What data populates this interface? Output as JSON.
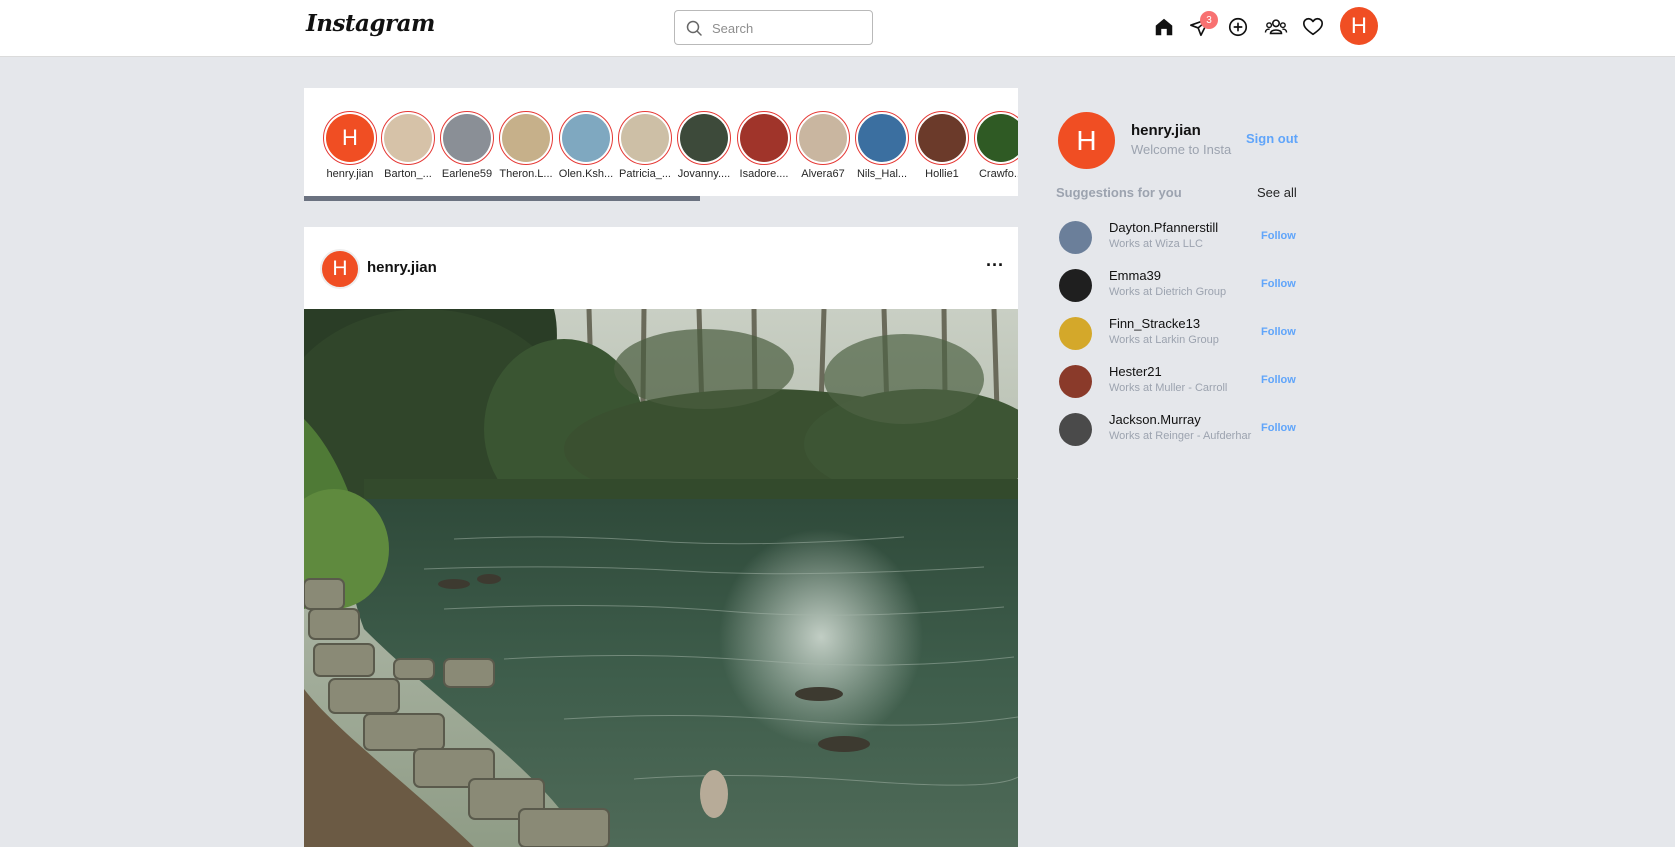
{
  "nav": {
    "logo": "Instagram",
    "search_placeholder": "Search",
    "messages_badge": "3",
    "avatar_initial": "H"
  },
  "stories": [
    {
      "name": "henry.jian",
      "initial": "H",
      "bg": "#f04e23"
    },
    {
      "name": "Barton_...",
      "bg": "#d6c2a8"
    },
    {
      "name": "Earlene59",
      "bg": "#8a8f96"
    },
    {
      "name": "Theron.L...",
      "bg": "#c6b08a"
    },
    {
      "name": "Olen.Ksh...",
      "bg": "#7fa8c0"
    },
    {
      "name": "Patricia_...",
      "bg": "#cdbfa6"
    },
    {
      "name": "Jovanny....",
      "bg": "#3d4a3a"
    },
    {
      "name": "Isadore....",
      "bg": "#a0342a"
    },
    {
      "name": "Alvera67",
      "bg": "#c9b6a0"
    },
    {
      "name": "Nils_Hal...",
      "bg": "#3b6fa0"
    },
    {
      "name": "Hollie1",
      "bg": "#6b3a2a"
    },
    {
      "name": "Crawfo...",
      "bg": "#2f5a24"
    }
  ],
  "post": {
    "user": "henry.jian",
    "avatar_initial": "H",
    "more": "···"
  },
  "sidebar": {
    "user": "henry.jian",
    "avatar_initial": "H",
    "welcome": "Welcome to Insta",
    "sign_out": "Sign out",
    "suggestions_title": "Suggestions for you",
    "see_all": "See all",
    "suggestions": [
      {
        "name": "Dayton.Pfannerstill",
        "work": "Works at Wiza LLC",
        "follow": "Follow",
        "bg": "#6b7f9a"
      },
      {
        "name": "Emma39",
        "work": "Works at Dietrich Group",
        "follow": "Follow",
        "bg": "#1f1f1f"
      },
      {
        "name": "Finn_Stracke13",
        "work": "Works at Larkin Group",
        "follow": "Follow",
        "bg": "#d4a82a"
      },
      {
        "name": "Hester21",
        "work": "Works at Muller - Carroll",
        "follow": "Follow",
        "bg": "#8a3a2a"
      },
      {
        "name": "Jackson.Murray",
        "work": "Works at Reinger - Aufderhar",
        "follow": "Follow",
        "bg": "#4a4a4a"
      }
    ]
  },
  "colors": {
    "accent": "#60a5fa",
    "avatar": "#f04e23",
    "story_ring": "#e53935",
    "badge": "#f87171"
  }
}
